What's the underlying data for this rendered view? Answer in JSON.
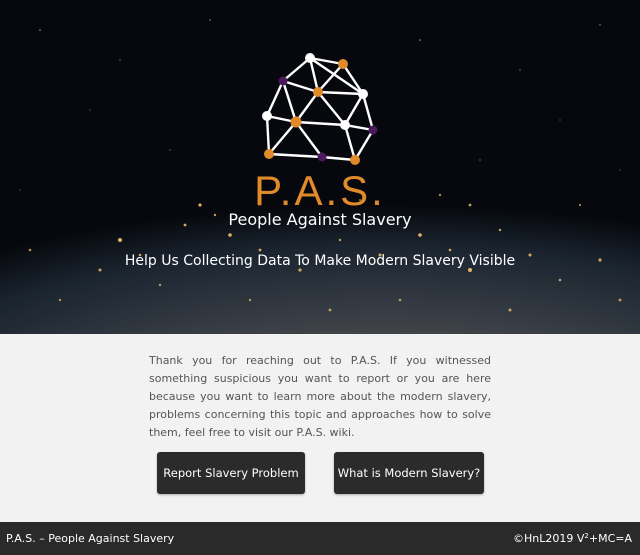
{
  "hero": {
    "brand": "P.A.S.",
    "subtitle": "People Against Slavery",
    "tagline": "Help Us Collecting Data To Make Modern Slavery Visible",
    "colors": {
      "accent": "#e08a2a",
      "node_purple": "#4a1a5c",
      "node_white": "#ffffff"
    },
    "logo_icon": "network-globe-icon"
  },
  "intro": {
    "text": "Thank you for reaching out to P.A.S. If you witnessed something suspicious you want to report or you are here because you want to learn more about the modern slavery, problems concerning this topic and approaches how to solve them, feel free to visit our P.A.S. wiki."
  },
  "buttons": {
    "report": "Report Slavery Problem",
    "what": "What is Modern Slavery?"
  },
  "footer": {
    "left": "P.A.S. – People Against Slavery",
    "right_prefix": "©HnL2019 V",
    "right_sup": "2",
    "right_suffix": "+MC=A"
  }
}
